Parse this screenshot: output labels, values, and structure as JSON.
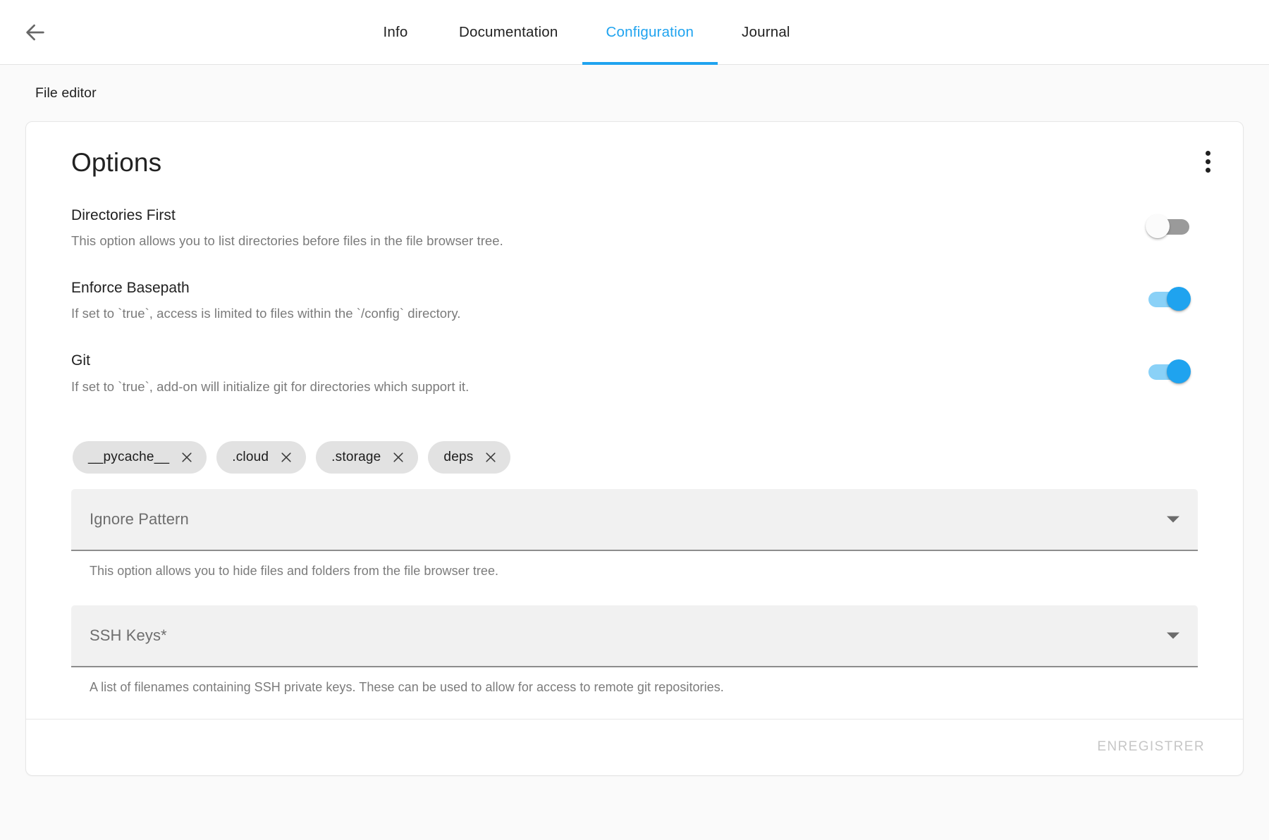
{
  "topbar": {
    "back_icon": "arrow-left-icon",
    "tabs": [
      {
        "label": "Info",
        "active": false
      },
      {
        "label": "Documentation",
        "active": false
      },
      {
        "label": "Configuration",
        "active": true
      },
      {
        "label": "Journal",
        "active": false
      }
    ],
    "active_tab": "Configuration",
    "accent_color": "#1fa3ef"
  },
  "page": {
    "label": "File editor"
  },
  "card": {
    "title": "Options",
    "overflow_icon": "more-vertical-icon",
    "options": [
      {
        "label": "Directories First",
        "description": "This option allows you to list directories before files in the file browser tree.",
        "toggle": "off"
      },
      {
        "label": "Enforce Basepath",
        "description": "If set to `true`, access is limited to files within the `/config` directory.",
        "toggle": "on"
      },
      {
        "label": "Git",
        "description": "If set to `true`, add-on will initialize git for directories which support it.",
        "toggle": "on"
      }
    ],
    "chips": [
      {
        "label": "__pycache__",
        "remove_icon": "close-icon"
      },
      {
        "label": ".cloud",
        "remove_icon": "close-icon"
      },
      {
        "label": ".storage",
        "remove_icon": "close-icon"
      },
      {
        "label": "deps",
        "remove_icon": "close-icon"
      }
    ],
    "fields": [
      {
        "label": "Ignore Pattern",
        "value": "",
        "help": "This option allows you to hide files and folders from the file browser tree.",
        "arrow_icon": "chevron-down-icon"
      },
      {
        "label": "SSH Keys*",
        "value": "",
        "help": "A list of filenames containing SSH private keys. These can be used to allow for access to remote git repositories.",
        "arrow_icon": "chevron-down-icon"
      }
    ],
    "footer": {
      "save_label": "ENREGISTRER",
      "save_disabled": true
    }
  }
}
